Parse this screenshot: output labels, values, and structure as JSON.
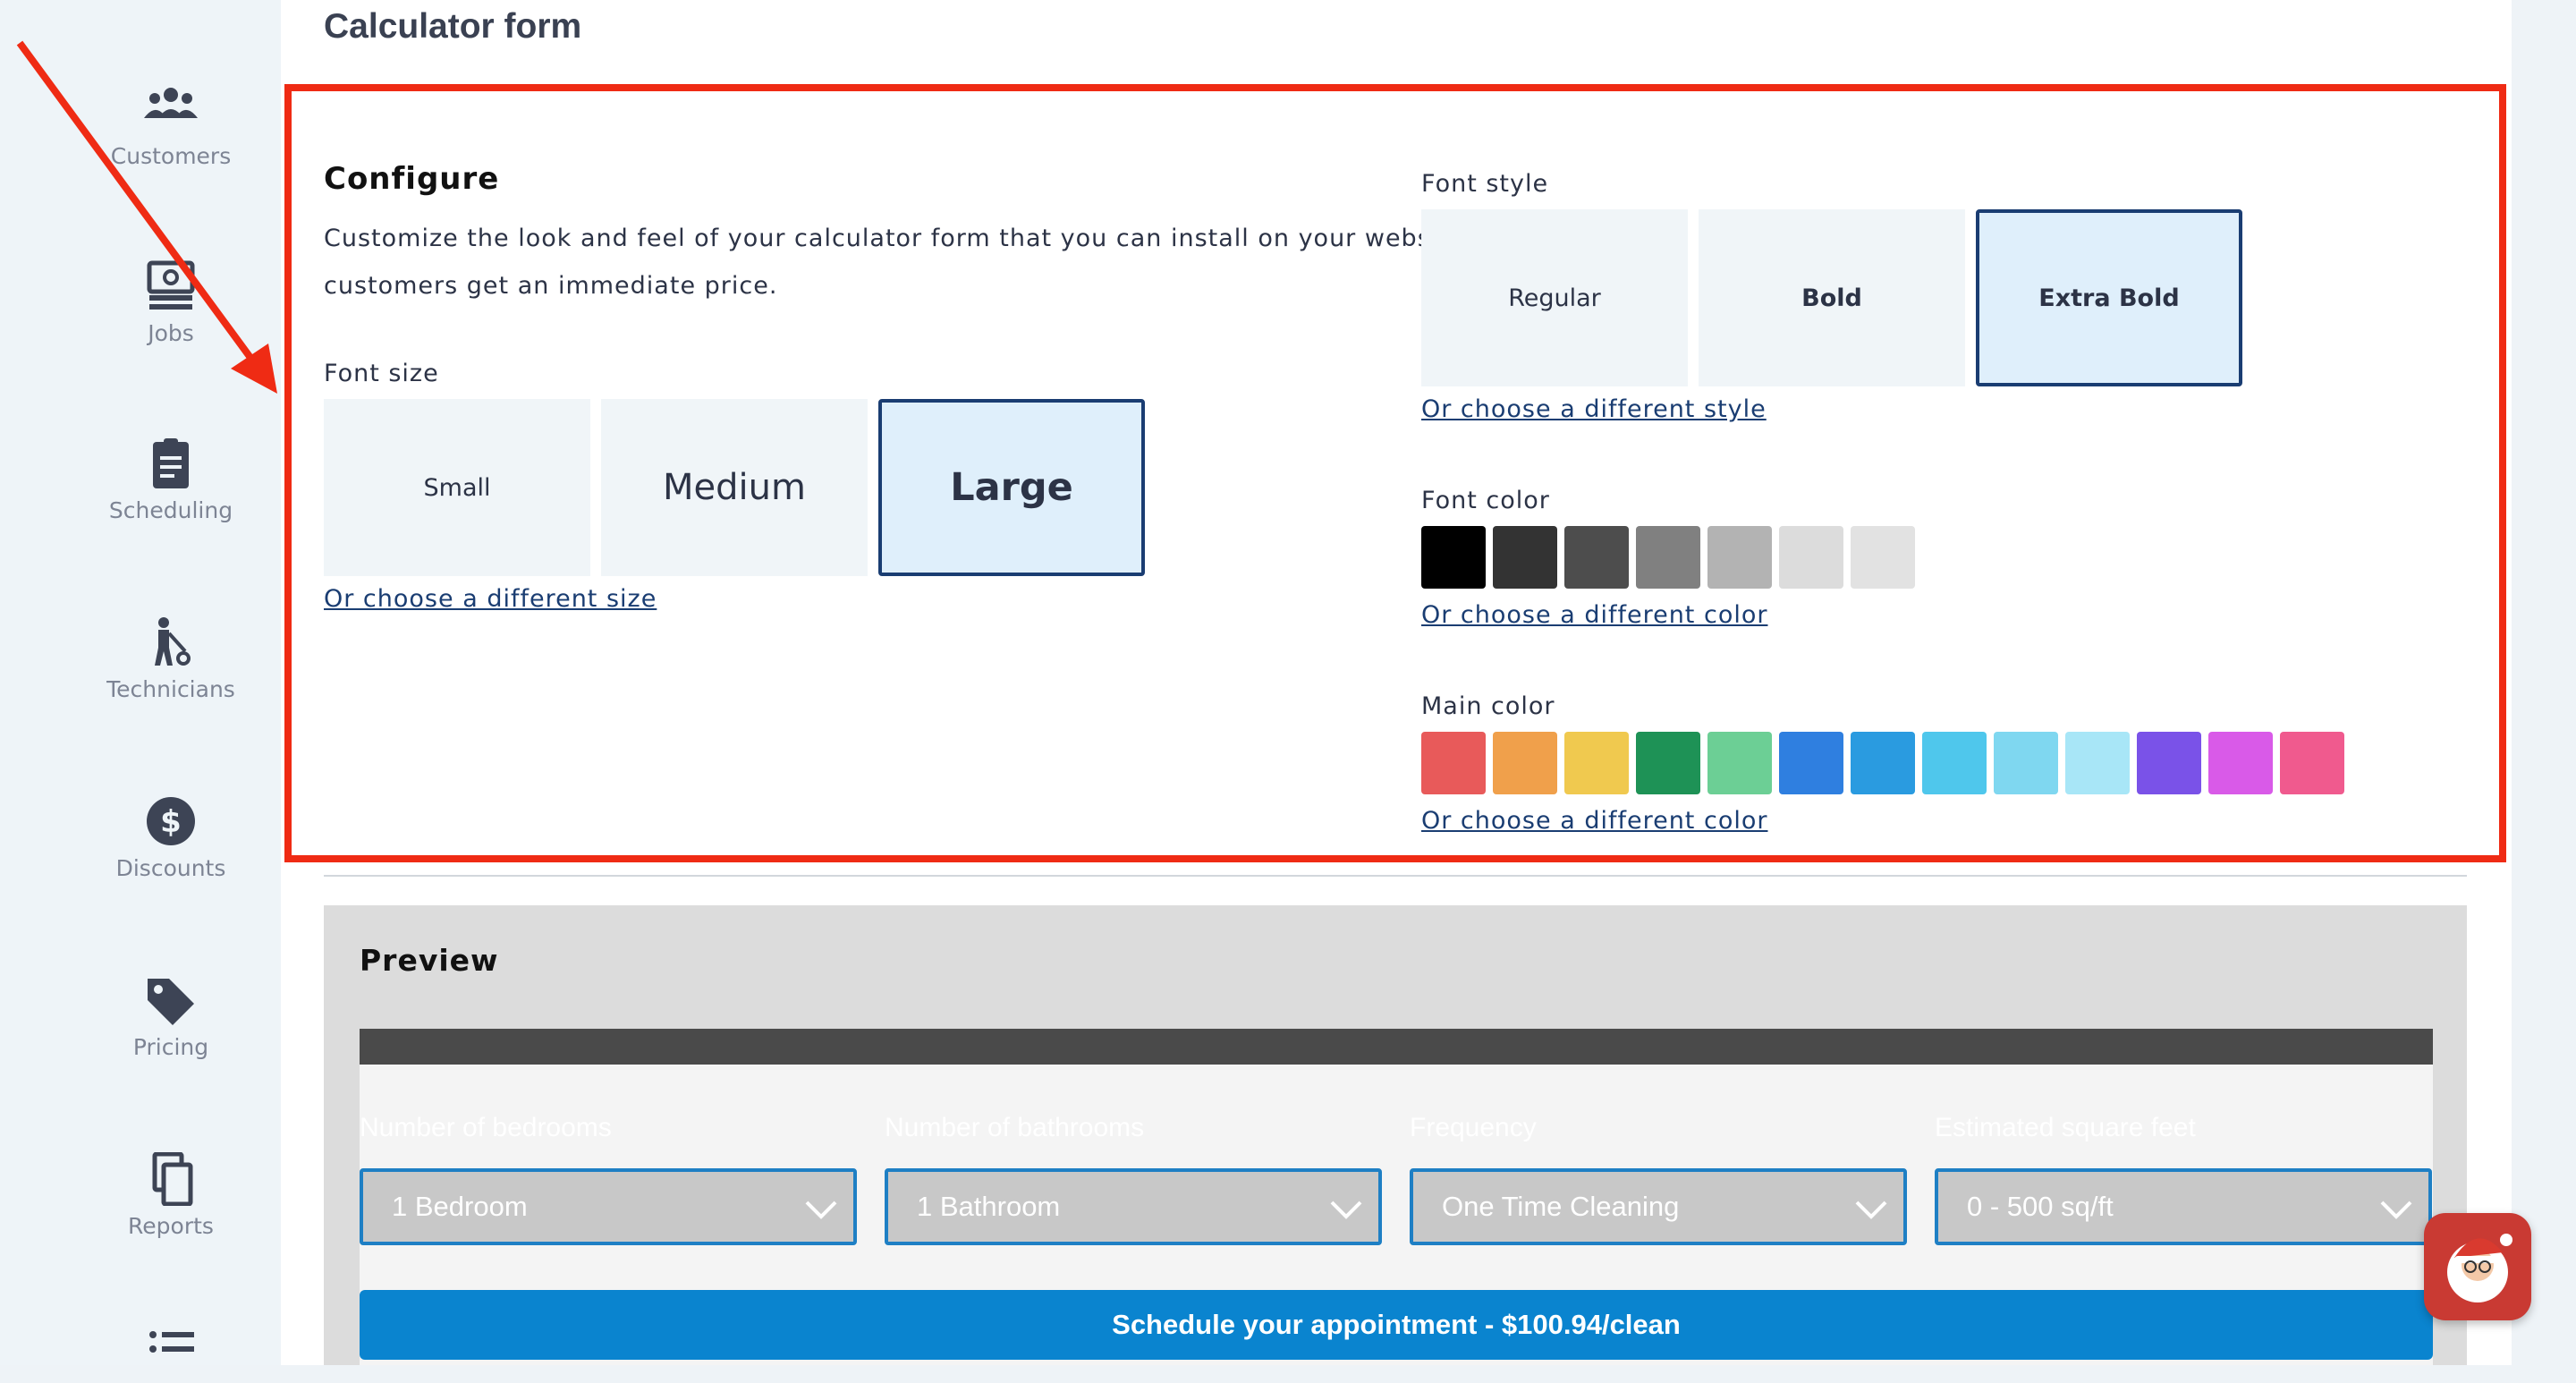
{
  "sidebar": {
    "items": [
      {
        "label": "Customers",
        "icon": "customers-icon"
      },
      {
        "label": "Jobs",
        "icon": "jobs-icon"
      },
      {
        "label": "Scheduling",
        "icon": "clipboard-icon"
      },
      {
        "label": "Technicians",
        "icon": "technician-icon"
      },
      {
        "label": "Discounts",
        "icon": "dollar-icon"
      },
      {
        "label": "Pricing",
        "icon": "tag-icon"
      },
      {
        "label": "Reports",
        "icon": "copy-icon"
      },
      {
        "label": "",
        "icon": "list-icon"
      }
    ]
  },
  "page": {
    "title": "Calculator form"
  },
  "configure": {
    "title": "Configure",
    "description": "Customize the look and feel of your calculator form that you can install on your website to help customers get an immediate price.",
    "font_size": {
      "label": "Font size",
      "options": [
        "Small",
        "Medium",
        "Large"
      ],
      "selected": "Large",
      "link": "Or choose a different size"
    },
    "font_style": {
      "label": "Font style",
      "options": [
        "Regular",
        "Bold",
        "Extra Bold"
      ],
      "selected": "Extra Bold",
      "link": "Or choose a different style"
    },
    "font_color": {
      "label": "Font color",
      "colors": [
        "#000000",
        "#333333",
        "#4d4d4d",
        "#808080",
        "#b3b3b3",
        "#dcdcdc",
        "#e2e2e2"
      ],
      "link": "Or choose a different color"
    },
    "main_color": {
      "label": "Main color",
      "colors": [
        "#e85a5a",
        "#f0a04b",
        "#f0c94f",
        "#1e9256",
        "#6ccf95",
        "#2f7fe0",
        "#2a9be0",
        "#4fc7ec",
        "#7fd7f0",
        "#a8e6f7",
        "#7a52e8",
        "#d95ae8",
        "#f05a8e"
      ],
      "link": "Or choose a different color"
    }
  },
  "preview": {
    "title": "Preview",
    "fields": [
      {
        "label": "Number of bedrooms",
        "value": "1 Bedroom"
      },
      {
        "label": "Number of bathrooms",
        "value": "1 Bathroom"
      },
      {
        "label": "Frequency",
        "value": "One Time Cleaning"
      },
      {
        "label": "Estimated square feet",
        "value": "0 - 500 sq/ft"
      }
    ],
    "button": "Schedule your appointment - $100.94/clean"
  },
  "colors": {
    "highlight": "#ef2b14",
    "selected_border": "#1a3d72",
    "link": "#1a3d72",
    "button": "#0a84cf"
  }
}
